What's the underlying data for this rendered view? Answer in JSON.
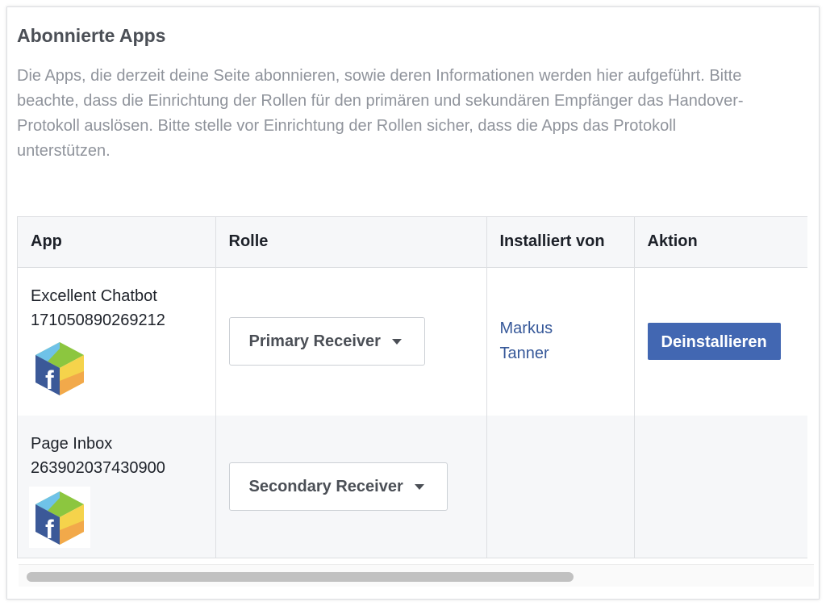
{
  "section": {
    "title": "Abonnierte Apps",
    "description": "Die Apps, die derzeit deine Seite abonnieren, sowie deren Informationen werden hier aufgeführt. Bitte beachte, dass die Einrichtung der Rollen für den primären und sekundären Empfänger das Handover-Protokoll auslösen. Bitte stelle vor Einrichtung der Rollen sicher, dass die Apps das Protokoll unterstützen."
  },
  "table": {
    "headers": [
      "App",
      "Rolle",
      "Installiert von",
      "Aktion"
    ],
    "rows": [
      {
        "app_name": "Excellent Chatbot",
        "app_id": "171050890269212",
        "icon": "facebook-app-cube-icon",
        "role": "Primary Receiver",
        "installed_by": "Markus Tanner",
        "action": "Deinstallieren"
      },
      {
        "app_name": "Page Inbox",
        "app_id": "263902037430900",
        "icon": "facebook-app-cube-icon",
        "role": "Secondary Receiver",
        "installed_by": "",
        "action": ""
      }
    ]
  },
  "colors": {
    "link": "#365899",
    "button": "#4267b2",
    "header_bg": "#f6f7f9",
    "muted_text": "#90949c"
  }
}
